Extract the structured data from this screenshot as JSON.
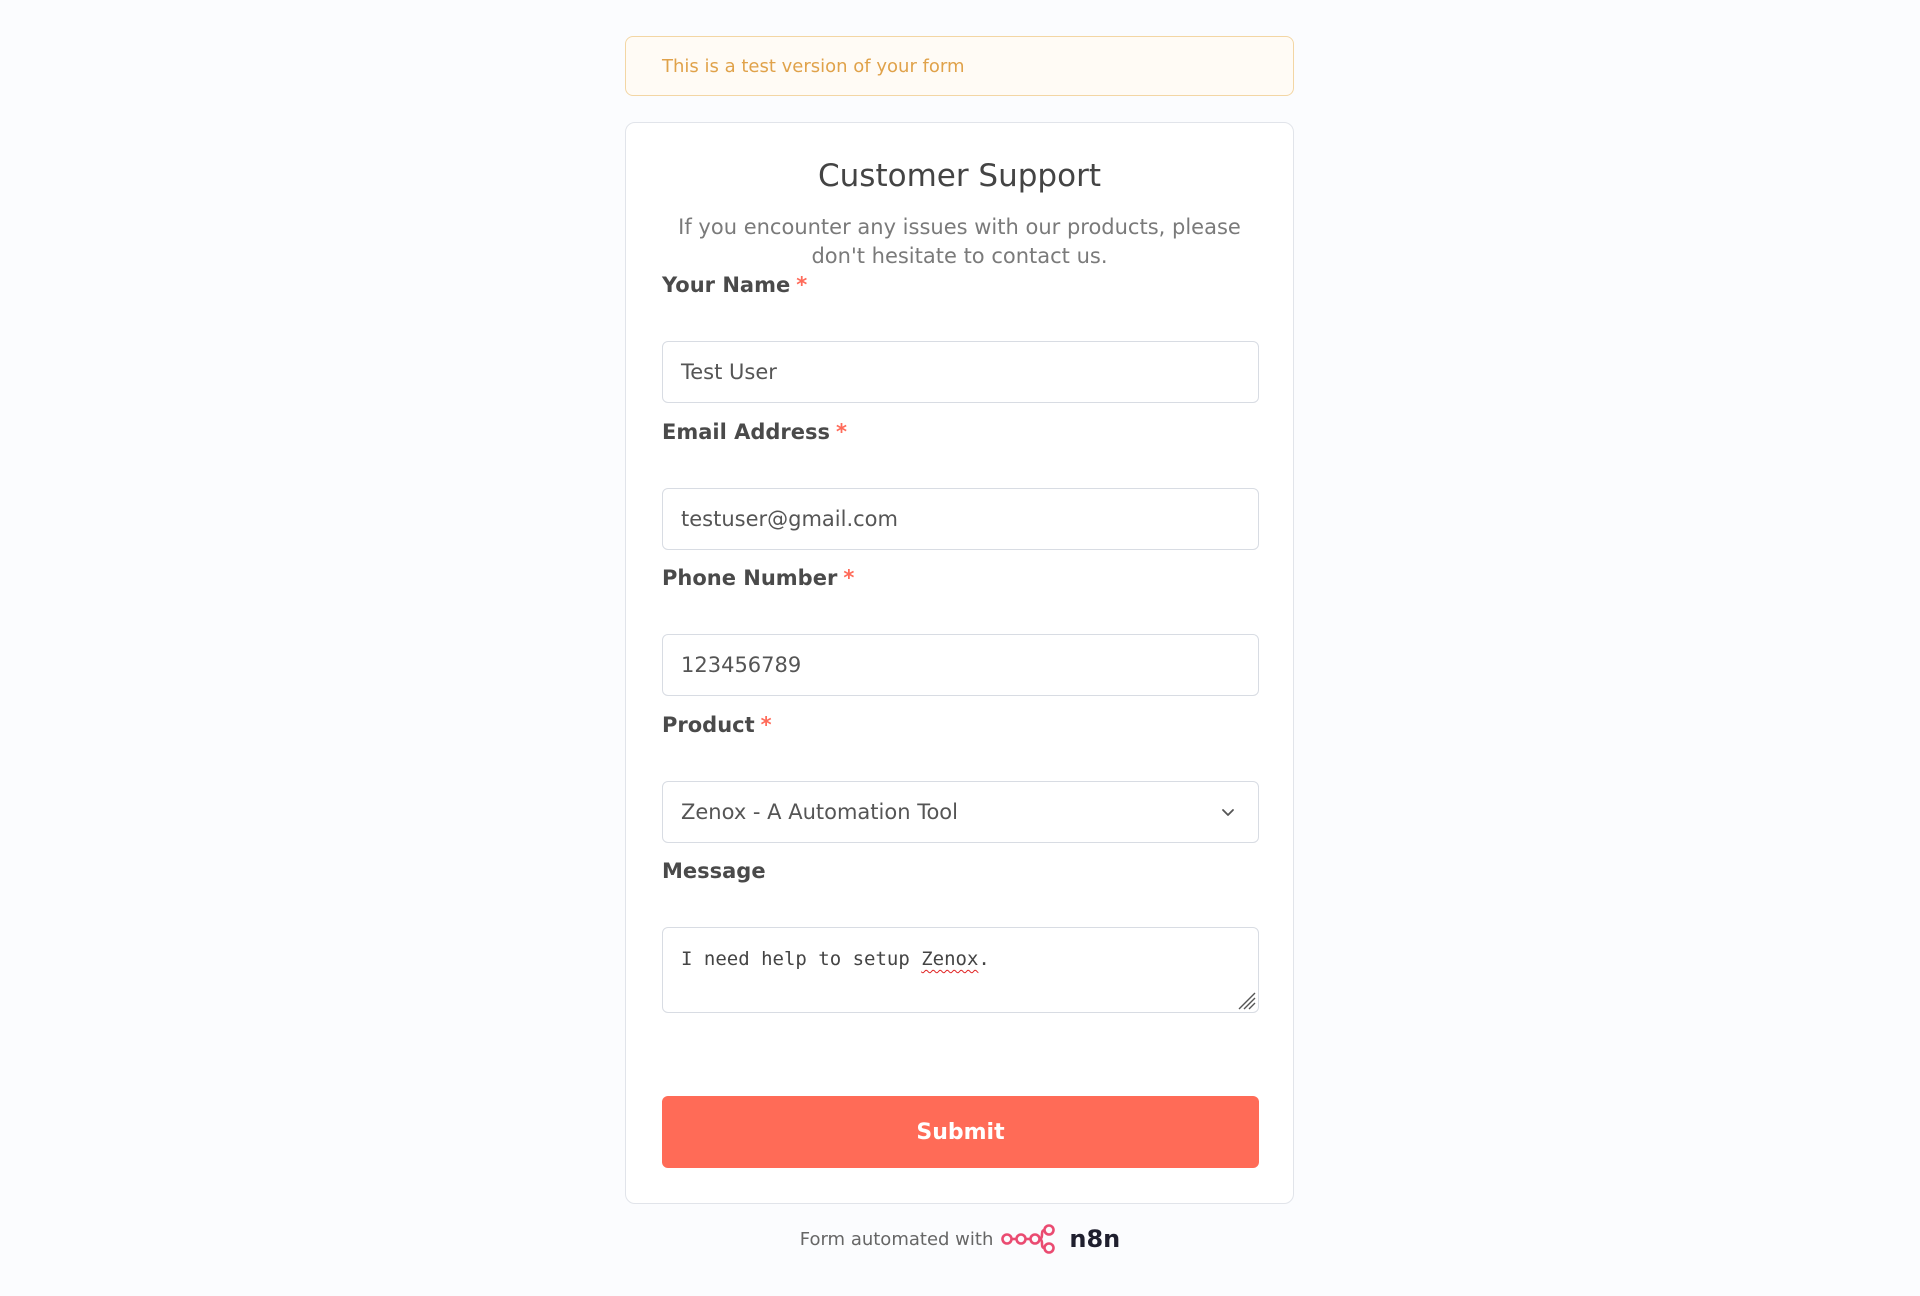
{
  "banner": {
    "text": "This is a test version of your form"
  },
  "form": {
    "title": "Customer Support",
    "description": "If you encounter any issues with our products, please don't hesitate to contact us.",
    "required_marker": "*",
    "fields": {
      "name": {
        "label": "Your Name",
        "value": "Test User",
        "required": true
      },
      "email": {
        "label": "Email Address",
        "value": "testuser@gmail.com",
        "required": true
      },
      "phone": {
        "label": "Phone Number",
        "value": "123456789",
        "required": true
      },
      "product": {
        "label": "Product",
        "selected": "Zenox - A Automation Tool",
        "required": true
      },
      "message": {
        "label": "Message",
        "value_prefix": "I need help to setup ",
        "value_misspelled": "Zenox",
        "value_suffix": ".",
        "required": false
      }
    },
    "submit_label": "Submit"
  },
  "footer": {
    "text": "Form automated with",
    "brand": "n8n"
  },
  "colors": {
    "accent": "#ff6b57",
    "required": "#ff6b5a",
    "banner_text": "#e0a24a",
    "banner_bg": "#fffbf5",
    "brand_logo": "#ea4b71"
  },
  "icons": {
    "select": "chevron-down-icon",
    "textarea_resize": "resize-handle-icon",
    "brand": "n8n-logo-icon"
  }
}
